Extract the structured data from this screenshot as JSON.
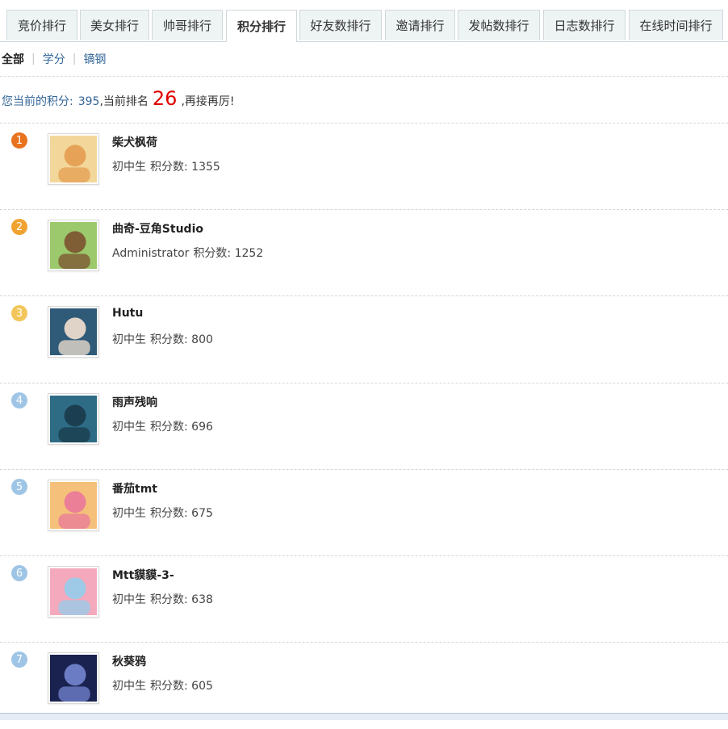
{
  "tabs": [
    {
      "label": "竞价排行",
      "active": false
    },
    {
      "label": "美女排行",
      "active": false
    },
    {
      "label": "帅哥排行",
      "active": false
    },
    {
      "label": "积分排行",
      "active": true
    },
    {
      "label": "好友数排行",
      "active": false
    },
    {
      "label": "邀请排行",
      "active": false
    },
    {
      "label": "发帖数排行",
      "active": false
    },
    {
      "label": "日志数排行",
      "active": false
    },
    {
      "label": "在线时间排行",
      "active": false
    }
  ],
  "filters": [
    {
      "label": "全部",
      "active": true
    },
    {
      "label": "学分",
      "active": false
    },
    {
      "label": "镝钢",
      "active": false
    }
  ],
  "score_line": {
    "label": "您当前的积分:",
    "value": "395",
    "middle": ",当前排名",
    "rank": "26",
    "suffix": ",再接再厉!"
  },
  "ranking": [
    {
      "rank": "1",
      "name": "柴犬枫荷",
      "group": "初中生",
      "score_label": "积分数:",
      "score": "1355",
      "badge_color": "#e8731e",
      "avatar_icon": "fox-avatar-icon",
      "avatar_colors": [
        "#f3d79a",
        "#e39a4c"
      ]
    },
    {
      "rank": "2",
      "name": "曲奇-豆角Studio",
      "group": "Administrator",
      "score_label": "积分数:",
      "score": "1252",
      "badge_color": "#f0a331",
      "avatar_icon": "cookie-avatar-icon",
      "avatar_colors": [
        "#9cc96b",
        "#7a4a2c"
      ]
    },
    {
      "rank": "3",
      "name": "Hutu",
      "group": "初中生",
      "score_label": "积分数:",
      "score": "800",
      "badge_color": "#f2c65a",
      "avatar_icon": "anime-girl-avatar-icon",
      "avatar_colors": [
        "#2f5a78",
        "#ffe9d6"
      ]
    },
    {
      "rank": "4",
      "name": "雨声残响",
      "group": "初中生",
      "score_label": "积分数:",
      "score": "696",
      "badge_color": "#9fc5e6",
      "avatar_icon": "silhouette-avatar-icon",
      "avatar_colors": [
        "#2e6c86",
        "#173646"
      ]
    },
    {
      "rank": "5",
      "name": "番茄tmt",
      "group": "初中生",
      "score_label": "积分数:",
      "score": "675",
      "badge_color": "#9fc5e6",
      "avatar_icon": "pink-hair-avatar-icon",
      "avatar_colors": [
        "#f5c17a",
        "#e8739c"
      ]
    },
    {
      "rank": "6",
      "name": "Mtt貘貘-3-",
      "group": "初中生",
      "score_label": "积分数:",
      "score": "638",
      "badge_color": "#9fc5e6",
      "avatar_icon": "cat-girl-avatar-icon",
      "avatar_colors": [
        "#f4a9bd",
        "#8fd0ef"
      ]
    },
    {
      "rank": "7",
      "name": "秋葵鸦",
      "group": "初中生",
      "score_label": "积分数:",
      "score": "605",
      "badge_color": "#9fc5e6",
      "avatar_icon": "night-avatar-icon",
      "avatar_colors": [
        "#1a2250",
        "#7a8cd8"
      ]
    }
  ]
}
